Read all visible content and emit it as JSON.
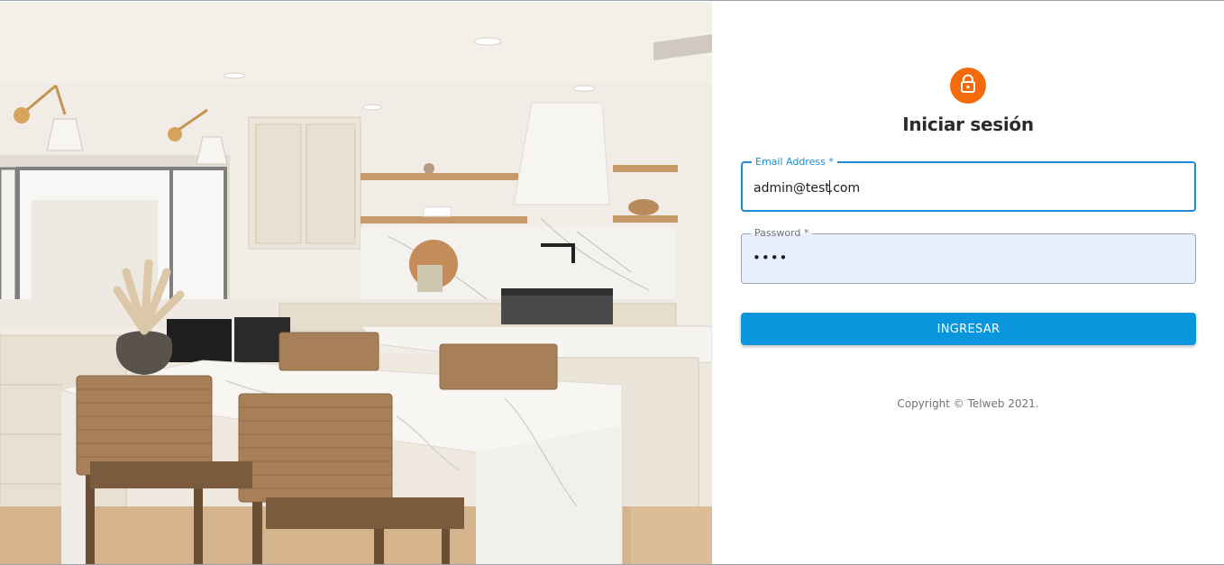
{
  "login": {
    "title": "Iniciar sesión",
    "email": {
      "label": "Email Address *",
      "value_before_caret": "admin@test",
      "value_after_caret": ".com"
    },
    "password": {
      "label": "Password *",
      "masked_value": "••••"
    },
    "submit_label": "INGRESAR",
    "copyright": "Copyright © Telweb 2021."
  },
  "icons": {
    "avatar": "lock-icon"
  },
  "colors": {
    "avatar_bg": "#f36b0b",
    "primary": "#0a96dc",
    "focus_border": "#1e8ad6",
    "autofill_bg": "#e8f0fe"
  }
}
